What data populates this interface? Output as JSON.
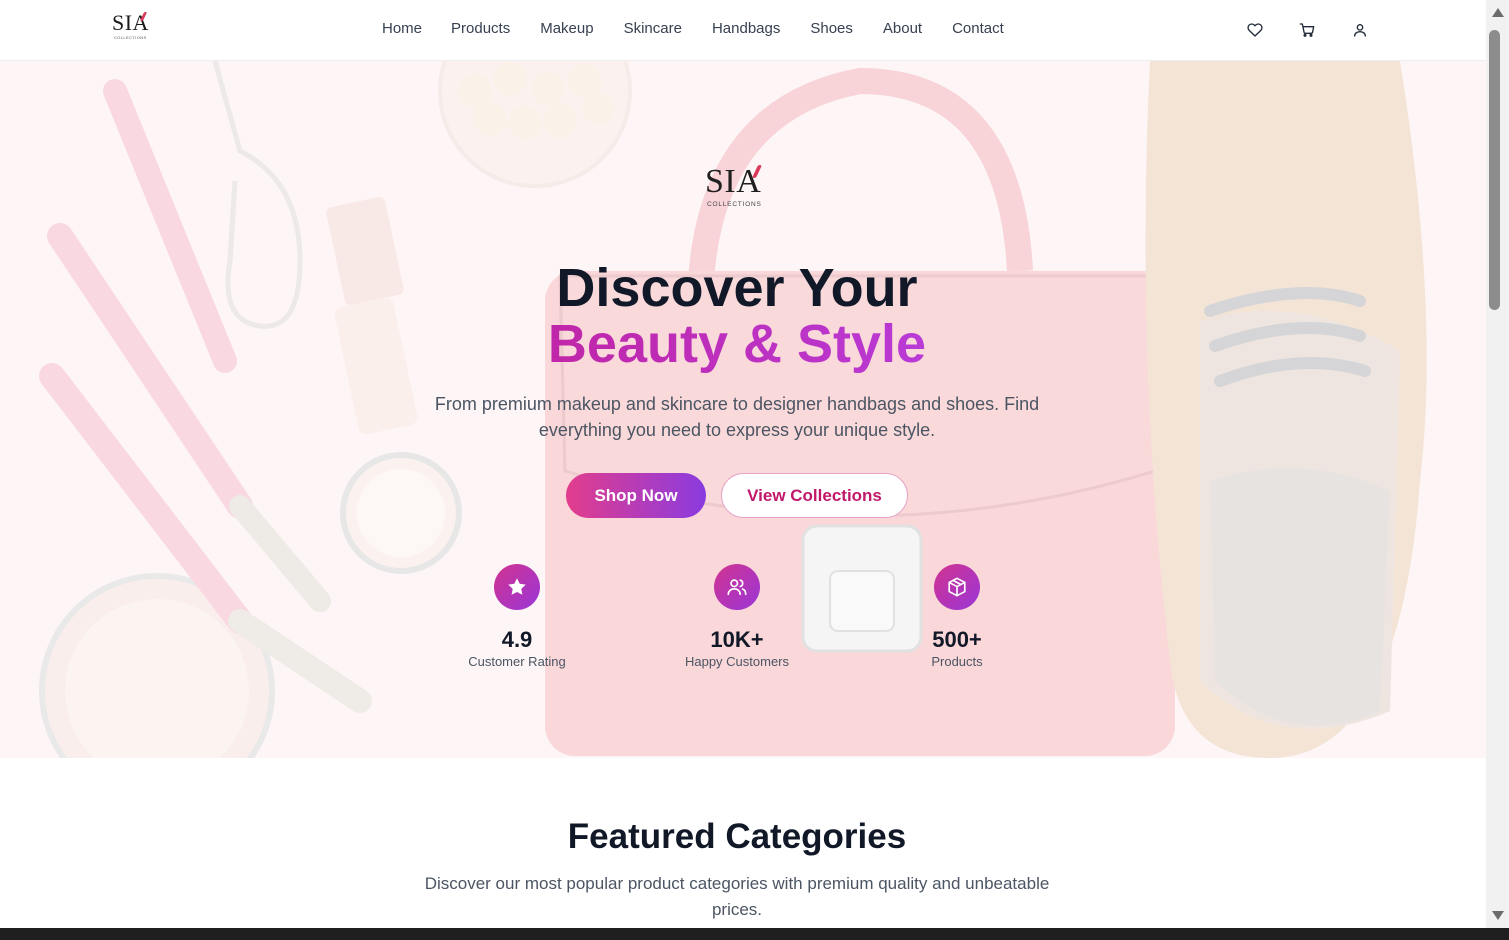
{
  "brand": {
    "logo_text": "SIA",
    "logo_subtext": "COLLECTIONS",
    "accent_pink": "#e23d8c",
    "accent_purple": "#8b3be0"
  },
  "header": {
    "nav": [
      {
        "label": "Home"
      },
      {
        "label": "Products"
      },
      {
        "label": "Makeup"
      },
      {
        "label": "Skincare"
      },
      {
        "label": "Handbags"
      },
      {
        "label": "Shoes"
      },
      {
        "label": "About"
      },
      {
        "label": "Contact"
      }
    ],
    "icons": [
      "heart-icon",
      "cart-icon",
      "user-icon"
    ]
  },
  "hero": {
    "title_line1": "Discover Your",
    "title_line2": "Beauty & Style",
    "description": "From premium makeup and skincare to designer handbags and shoes. Find everything you need to express your unique style.",
    "primary_button": "Shop Now",
    "secondary_button": "View Collections",
    "stats": [
      {
        "icon": "star-icon",
        "value": "4.9",
        "label": "Customer Rating"
      },
      {
        "icon": "users-icon",
        "value": "10K+",
        "label": "Happy Customers"
      },
      {
        "icon": "box-icon",
        "value": "500+",
        "label": "Products"
      }
    ]
  },
  "featured": {
    "title": "Featured Categories",
    "description": "Discover our most popular product categories with premium quality and unbeatable prices."
  }
}
